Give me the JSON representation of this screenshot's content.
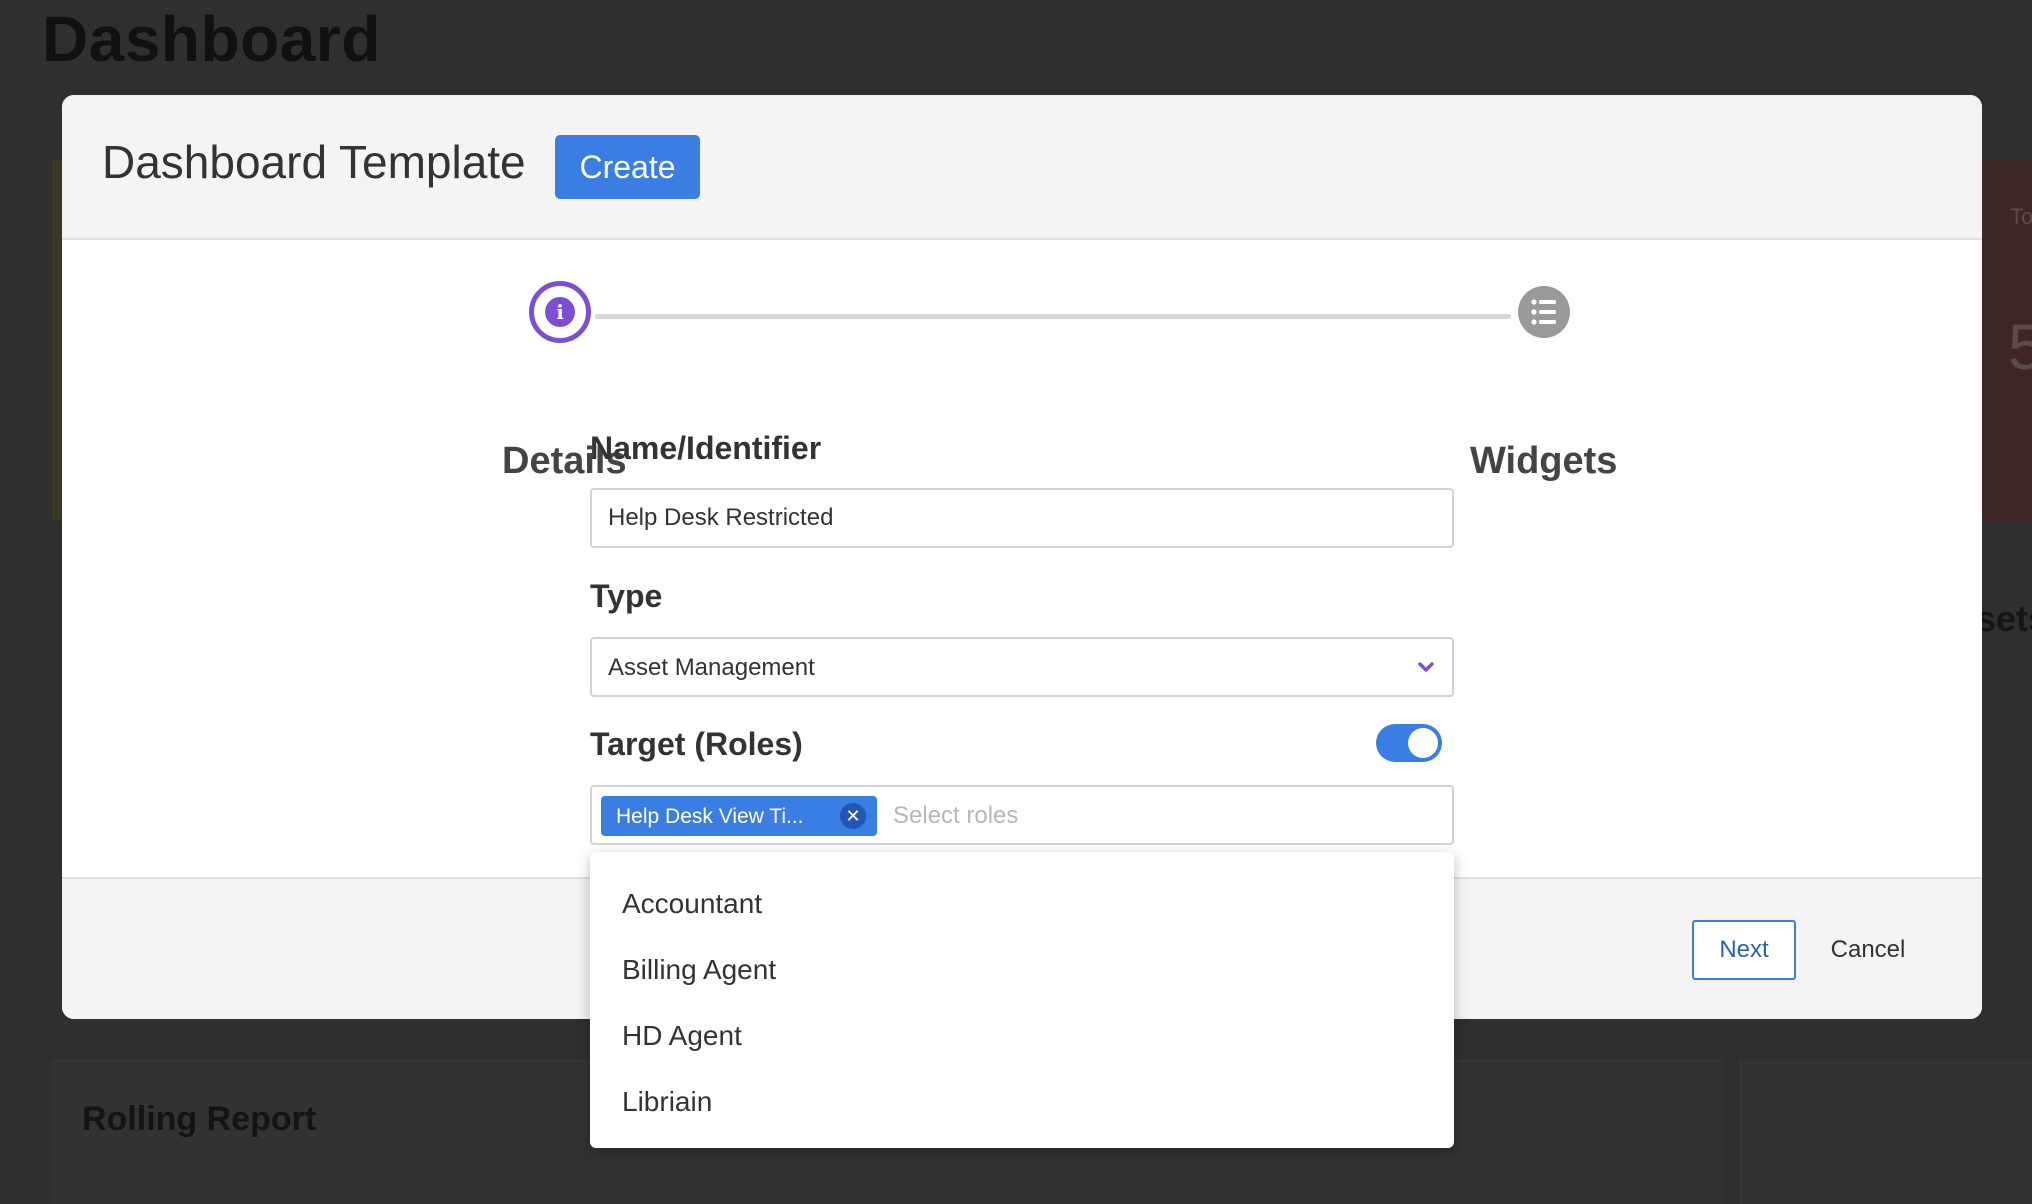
{
  "background": {
    "page_title": "Dashboard",
    "side_card_partial": "To",
    "side_card_number_partial": "5",
    "side_text_partial": "sets",
    "panel_title": "Rolling Report"
  },
  "modal": {
    "title": "Dashboard Template",
    "create_label": "Create",
    "steps": [
      {
        "label": "Details",
        "icon": "info-icon",
        "active": true
      },
      {
        "label": "Widgets",
        "icon": "list-icon",
        "active": false
      }
    ],
    "fields": {
      "name": {
        "label": "Name/Identifier",
        "value": "Help Desk Restricted"
      },
      "type": {
        "label": "Type",
        "value": "Asset Management"
      },
      "target": {
        "label": "Target (Roles)",
        "toggle_on": true,
        "selected_chip": "Help Desk View Ti...",
        "placeholder": "Select roles"
      }
    },
    "footer": {
      "next_label": "Next",
      "cancel_label": "Cancel"
    }
  },
  "roles_dropdown": {
    "options": [
      "Accountant",
      "Billing Agent",
      "HD Agent",
      "Libriain"
    ]
  },
  "colors": {
    "accent_blue": "#3b7ee3",
    "step_purple": "#7a4fd1",
    "overlay": "#2f2f2f"
  }
}
